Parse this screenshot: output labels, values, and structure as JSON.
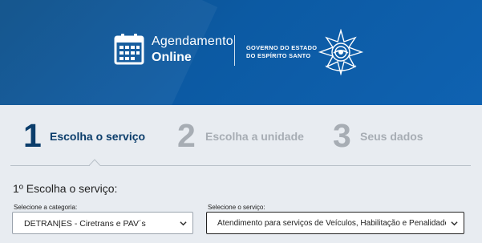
{
  "header": {
    "app_title_line1": "Agendamento",
    "app_title_line2": "Online",
    "gov_line1": "GOVERNO DO ESTADO",
    "gov_line2": "DO ESPÍRITO SANTO",
    "icons": [
      "calendar-icon",
      "coat-of-arms-icon"
    ],
    "background_color": "#0c5aa3"
  },
  "steps": [
    {
      "number": "1",
      "label": "Escolha o serviço",
      "active": true
    },
    {
      "number": "2",
      "label": "Escolha a unidade",
      "active": false
    },
    {
      "number": "3",
      "label": "Seus dados",
      "active": false
    }
  ],
  "form": {
    "heading": "1º Escolha o serviço:",
    "category_label": "Selecione a categoria:",
    "category_value": "DETRAN|ES - Ciretrans e PAV´s",
    "service_label": "Selecione o serviço:",
    "service_value": "Atendimento para serviços de Veículos, Habilitação e Penalidade nas C"
  },
  "colors": {
    "active_step": "#0b3d6b",
    "inactive_step": "#a7adb4",
    "page_bg": "#e8ecf1"
  }
}
